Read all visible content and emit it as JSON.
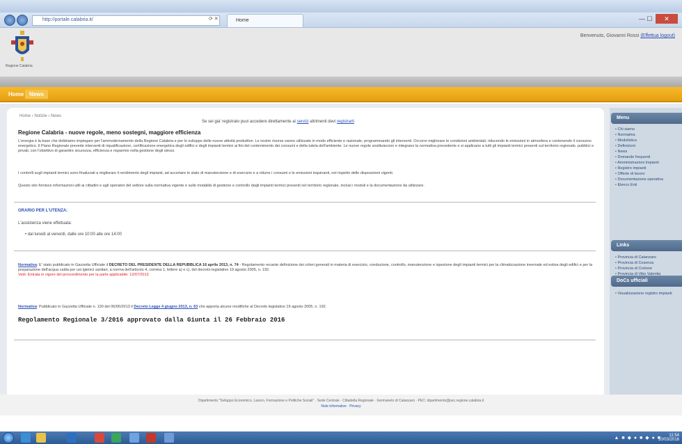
{
  "browser": {
    "address": "http://portale.calabria.it/",
    "tab_title": "Home",
    "close_label": "✕"
  },
  "site": {
    "logo_text": "Regione Calabria",
    "welcome_prefix": "Benvenuto, Giovanni Rossi",
    "logout": "(Effettua logout)"
  },
  "nav": {
    "home": "Home",
    "active": "News"
  },
  "breadcrumb": "Home › Notizie › News",
  "notice": {
    "prefix": "Se sei gia' registrato puoi accedere direttamente ai",
    "link1": "servizi",
    "mid": "altrimenti devi",
    "link2": "registrarti"
  },
  "content": {
    "title": "Regione Calabria - nuove regole, meno sostegni, maggiore efficienza",
    "p1": "L'energia è la base che dobbiamo impiegare per l'ammodernamento della Regione Calabria e per lo sviluppo delle nuove attività produttive. Le nostre risorse vanno utilizzate in modo efficiente e razionale, programmando gli interventi. Occorre migliorare le condizioni ambientali, riducendo le emissioni in atmosfera e contenendo il consumo energetico. Il Piano Regionale prevede interventi di riqualificazione, certificazione energetica degli edifici e degli impianti termici ai fini del contenimento dei consumi e della tutela dell'ambiente. Le nuove regole sostituiscono e integrano la normativa precedente e si applicano a tutti gli impianti termici presenti sul territorio regionale, pubblici e privati, con l'obiettivo di garantire sicurezza, efficienza e risparmio nella gestione degli stessi.",
    "p2": "I controlli sugli impianti termici sono finalizzati a migliorare il rendimento degli impianti, ad accertare lo stato di manutenzione e di esercizio e a ridurre i consumi e le emissioni inquinanti, nel rispetto delle disposizioni vigenti.",
    "p3": "Questo sito fornisce informazioni utili ai cittadini e agli operatori del settore sulla normativa vigente e sulle modalità di gestione e controllo degli impianti termici presenti nel territorio regionale, inclusi i moduli e la documentazione da utilizzare.",
    "section_title": "ORARIO PER L'UTENZA:",
    "hours_intro": "L'assistenza viene effettuata:",
    "hours_bullet": "dal lunedì al venerdì, dalle ore 10:00 alle ore 14:00"
  },
  "news": [
    {
      "label": "Normativa",
      "text_a": ": E' stato pubblicato in Gazzetta Ufficiale il",
      "bold": "DECRETO DEL PRESIDENTE DELLA REPUBBLICA 16 aprile 2013, n. 74",
      "text_b": "- Regolamento recante definizione dei criteri generali in materia di esercizio, conduzione, controllo, manutenzione e ispezione degli impianti termici per la climatizzazione invernale ed estiva degli edifici e per la preparazione dell'acqua calda per usi igienici sanitari, a norma dell'articolo 4, comma 1, lettere a) e c), del decreto legislativo 19 agosto 2005, n. 192.",
      "red": "Vedi: Entrata in vigore del provvedimento per la parte applicabile: 12/07/2013"
    },
    {
      "label": "Normativa",
      "text_a": ": Pubblicato in Gazzetta Ufficiale n. 130 del 06/06/2013 il",
      "link": "Decreto Legge 4 giugno 2013, n. 63",
      "text_b": "che apporta alcune modifiche al Decreto legislativo 19 agosto 2005, n. 192."
    }
  ],
  "regulation": "Regolamento Regionale 3/2016 approvato dalla Giunta il 26 Febbraio 2016",
  "sidebar": {
    "sections": [
      {
        "title": "Menu",
        "items": [
          "Chi siamo",
          "Normativa",
          "Modulistica",
          "Definizioni",
          "News",
          "Domande frequenti",
          "Amministrazioni Impianti",
          "Registro impianti",
          "Offerte di lavoro",
          "Documentazione operativa",
          "Elenco Enti"
        ]
      },
      {
        "title": "Links",
        "items": [
          "Provincia di Catanzaro",
          "Provincia di Cosenza",
          "Provincia di Crotone",
          "Provincia di Vibo Valentia"
        ]
      },
      {
        "title": "DoCs ufficiali",
        "items": [
          "Visualizzazione registro impianti"
        ]
      }
    ]
  },
  "footer": {
    "line1": "Dipartimento \"Sviluppo Economico, Lavoro, Formazione e Politiche Sociali\" · Sede Centrale · Cittadella Regionale · Germaneto di Catanzaro · PEC: dipartimento@pec.regione.calabria.it",
    "line2": "Note informative · Privacy"
  },
  "taskbar": {
    "tray": "▲ ■ ◆ ● ■ ◆ ● ■",
    "time": "11:54",
    "date": "10/03/2016"
  }
}
